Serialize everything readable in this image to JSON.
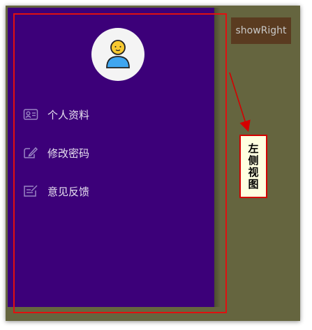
{
  "drawer": {
    "background": "#3c0079",
    "avatar_icon": "user-avatar-icon",
    "menu": [
      {
        "label": "个人资料",
        "icon": "profile-card-icon"
      },
      {
        "label": "修改密码",
        "icon": "edit-password-icon"
      },
      {
        "label": "意见反馈",
        "icon": "feedback-icon"
      }
    ]
  },
  "toolbar": {
    "show_right_label": "showRight"
  },
  "annotation": {
    "callout_text": "左侧视图",
    "outline_color": "#e01010"
  },
  "content": {
    "background": "#65653f",
    "button_color": "#5a3b20"
  }
}
